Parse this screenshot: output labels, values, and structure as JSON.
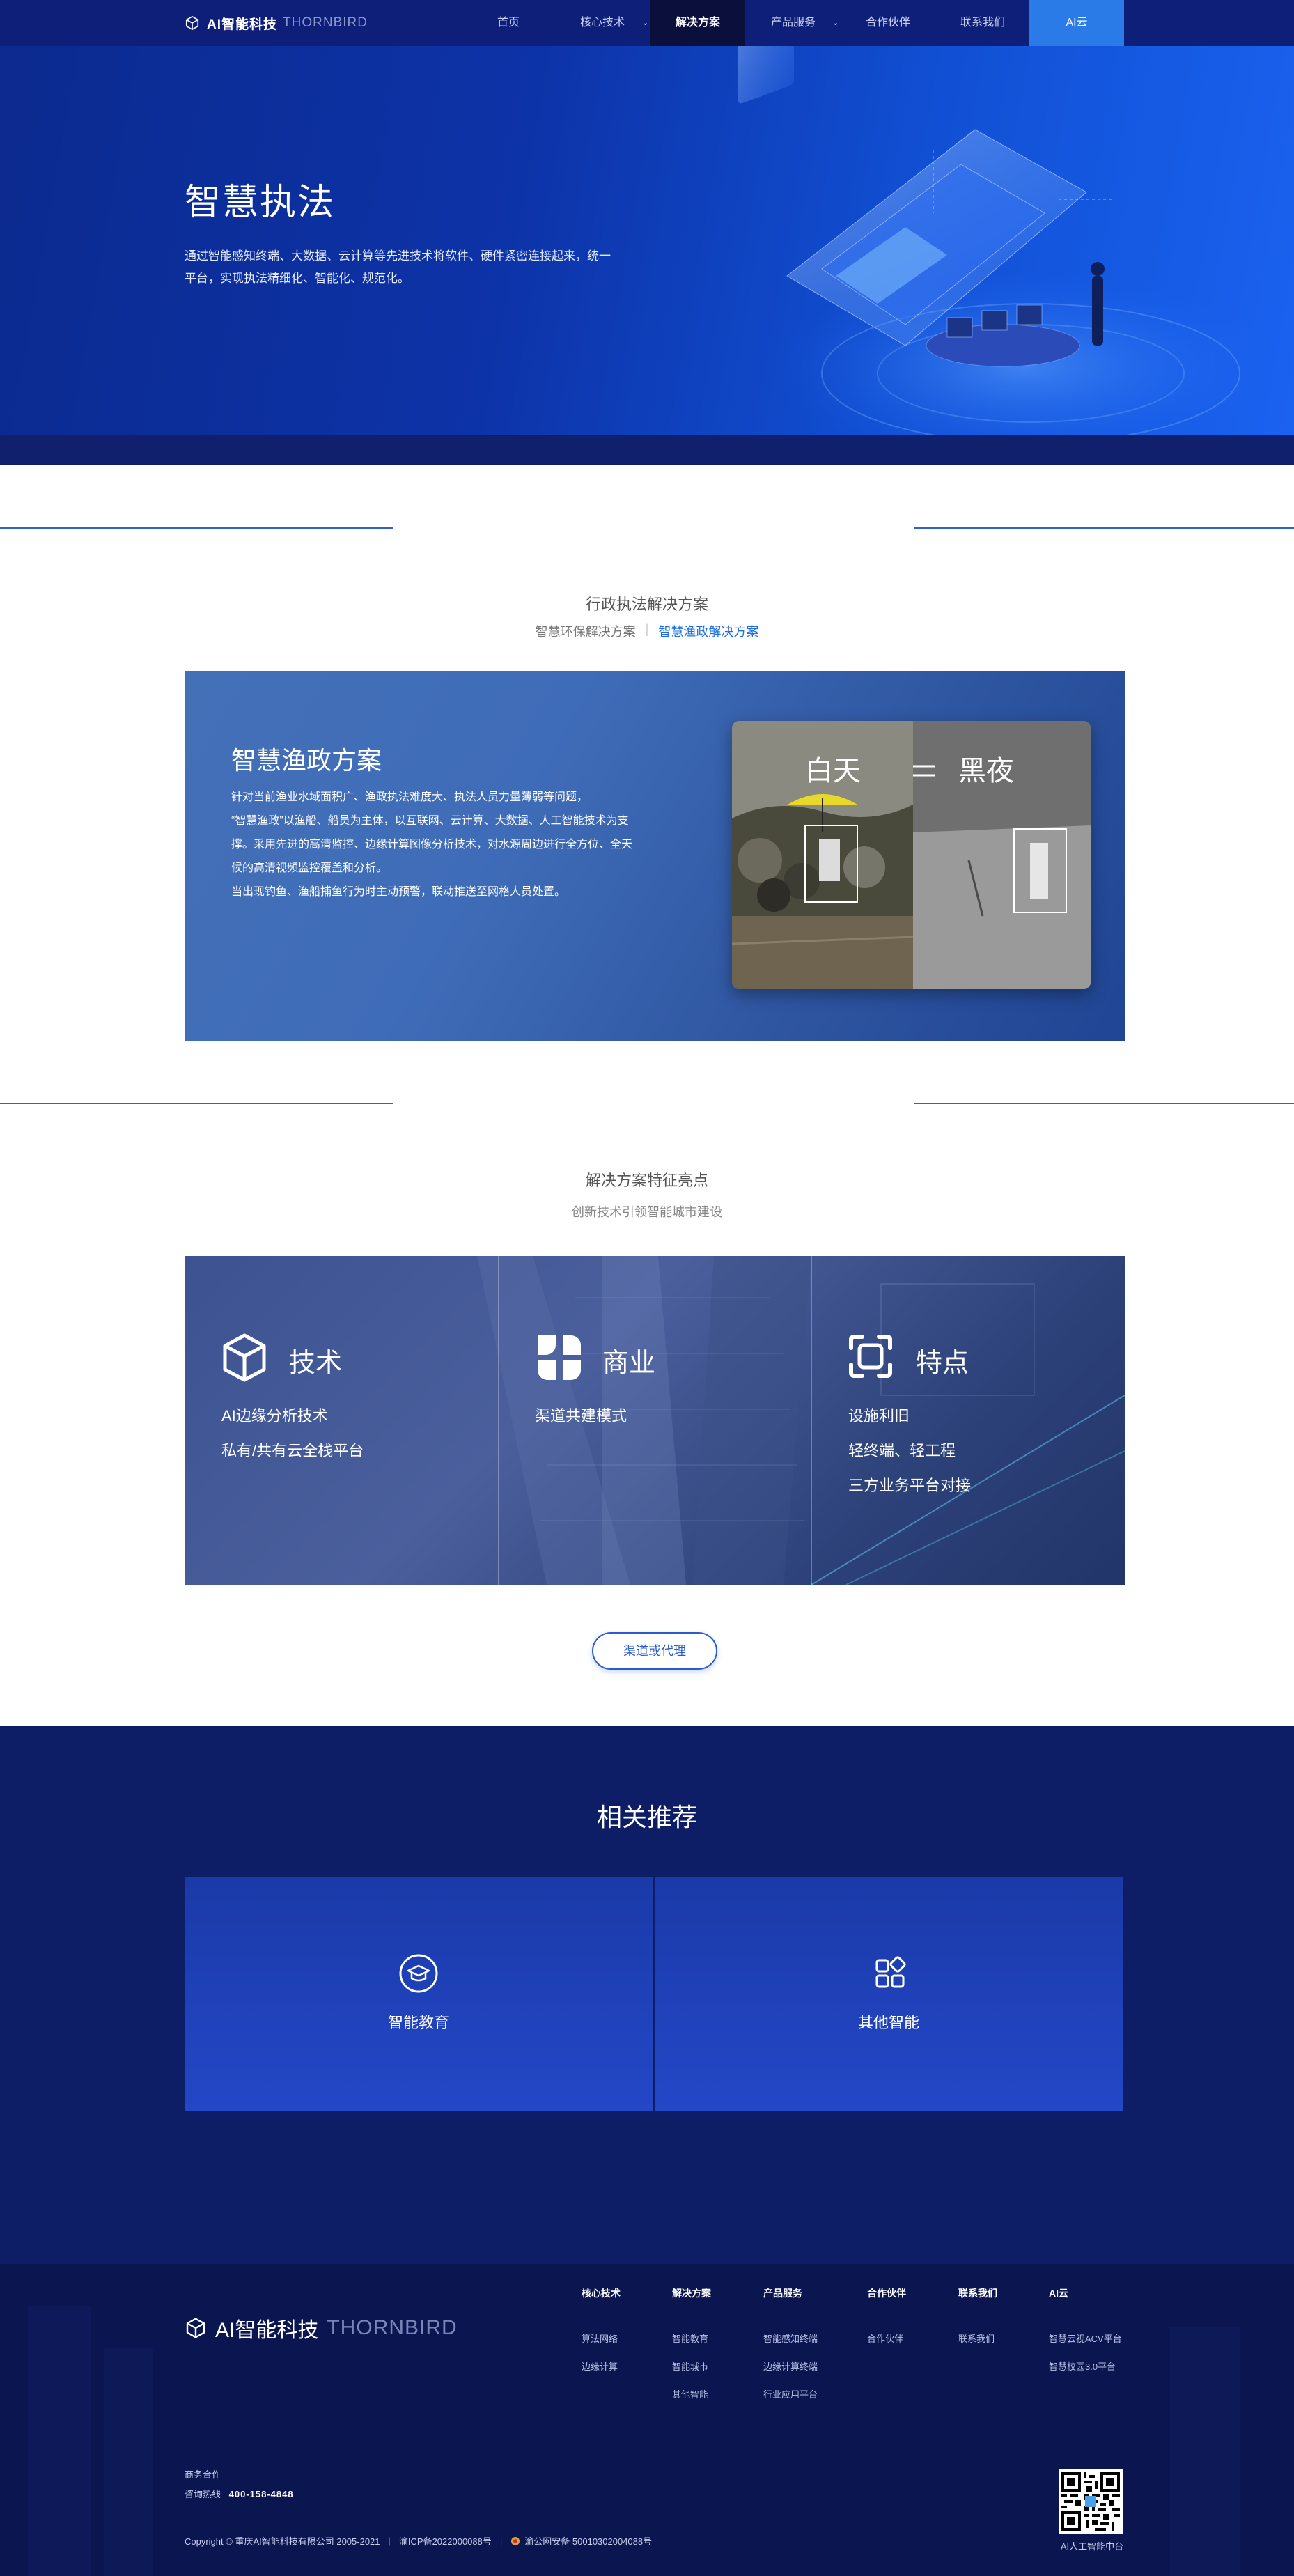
{
  "nav": {
    "logo_cn": "AI智能科技",
    "logo_en": "THORNBIRD",
    "items": [
      {
        "label": "首页"
      },
      {
        "label": "核心技术"
      },
      {
        "label": "解决方案"
      },
      {
        "label": "产品服务"
      },
      {
        "label": "合作伙伴"
      },
      {
        "label": "联系我们"
      },
      {
        "label": "AI云"
      }
    ],
    "active_index": 2,
    "colors": {
      "bar": "#0e1f7a",
      "active": "#0a0f3c",
      "cloud": "#2a7be8"
    }
  },
  "hero": {
    "title": "智慧执法",
    "desc": "通过智能感知终端、大数据、云计算等先进技术将软件、硬件紧密连接起来，统一平台，实现执法精细化、智能化、规范化。"
  },
  "solutions": {
    "title": "行政执法解决方案",
    "tabs": [
      {
        "label": "智慧环保解决方案",
        "selected": false
      },
      {
        "label": "智慧渔政解决方案",
        "selected": true
      }
    ],
    "card": {
      "title": "智慧渔政方案",
      "desc_lines": [
        "针对当前渔业水域面积广、渔政执法难度大、执法人员力量薄弱等问题，",
        "“智慧渔政”以渔船、船员为主体，以互联网、云计算、大数据、人工智能技术为支",
        "撑。采用先进的高清监控、边缘计算图像分析技术，对水源周边进行全方位、全天",
        "候的高清视频监控覆盖和分析。",
        "当出现钓鱼、渔船捕鱼行为时主动预警，联动推送至网格人员处置。"
      ],
      "photo_day": "白天",
      "photo_night": "黑夜"
    }
  },
  "features": {
    "title": "解决方案特征亮点",
    "subtitle": "创新技术引领智能城市建设",
    "columns": [
      {
        "icon": "cube-icon",
        "title": "技术",
        "items": [
          "AI边缘分析技术",
          "私有/共有云全栈平台"
        ]
      },
      {
        "icon": "clover-icon",
        "title": "商业",
        "items": [
          "渠道共建模式"
        ]
      },
      {
        "icon": "focus-icon",
        "title": "特点",
        "items": [
          "设施利旧",
          "轻终端、轻工程",
          "三方业务平台对接"
        ]
      }
    ],
    "button": "渠道或代理"
  },
  "related": {
    "title": "相关推荐",
    "cards": [
      {
        "icon": "graduation-cap-icon",
        "label": "智能教育"
      },
      {
        "icon": "apps-icon",
        "label": "其他智能"
      }
    ]
  },
  "footer": {
    "logo_cn": "AI智能科技",
    "logo_en": "THORNBIRD",
    "columns": [
      {
        "head": "核心技术",
        "links": [
          "算法网络",
          "边缘计算"
        ]
      },
      {
        "head": "解决方案",
        "links": [
          "智能教育",
          "智能城市",
          "其他智能"
        ]
      },
      {
        "head": "产品服务",
        "links": [
          "智能感知终端",
          "边缘计算终端",
          "行业应用平台"
        ]
      },
      {
        "head": "合作伙伴",
        "links": [
          "合作伙伴"
        ]
      },
      {
        "head": "联系我们",
        "links": [
          "联系我们"
        ]
      },
      {
        "head": "AI云",
        "links": [
          "智慧云视ACV平台",
          "智慧校园3.0平台"
        ]
      }
    ],
    "business_label": "商务合作",
    "hotline_label": "咨询热线",
    "hotline": "400-158-4848",
    "copyright": "Copyright © 重庆AI智能科技有限公司 2005-2021",
    "icp": "渝ICP备2022000088号",
    "police": "渝公网安备 50010302004088号",
    "qr_label": "AI人工智能中台"
  }
}
